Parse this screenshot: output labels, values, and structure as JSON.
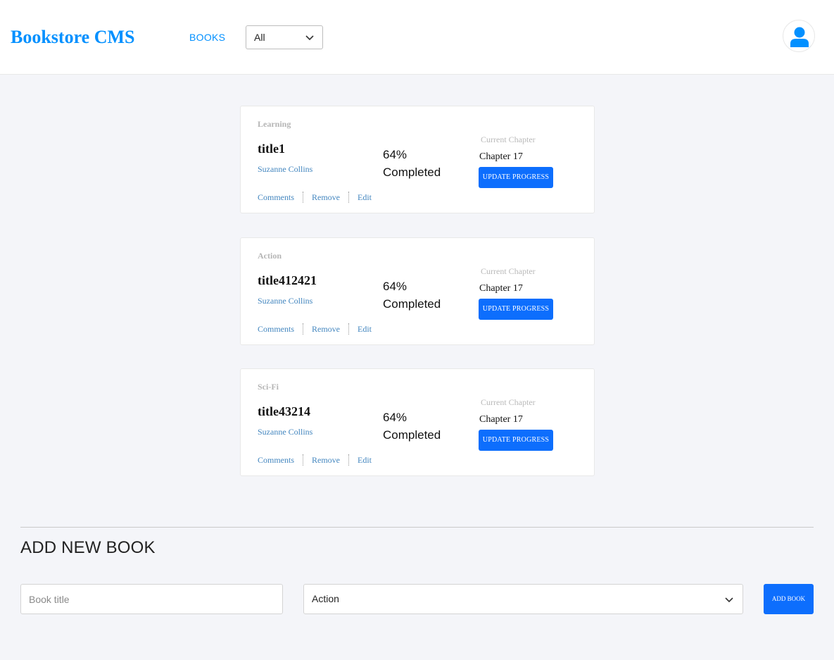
{
  "header": {
    "brand": "Bookstore CMS",
    "nav_books": "BOOKS",
    "filter_value": "All",
    "avatar_icon": "user-icon"
  },
  "books": [
    {
      "category": "Learning",
      "title": "title1",
      "author": "Suzanne Collins",
      "actions": [
        "Comments",
        "Remove",
        "Edit"
      ],
      "progress_percent": "64%",
      "progress_label": "Completed",
      "current_chapter_label": "Current Chapter",
      "chapter": "Chapter 17",
      "update_label": "UPDATE PROGRESS"
    },
    {
      "category": "Action",
      "title": "title412421",
      "author": "Suzanne Collins",
      "actions": [
        "Comments",
        "Remove",
        "Edit"
      ],
      "progress_percent": "64%",
      "progress_label": "Completed",
      "current_chapter_label": "Current Chapter",
      "chapter": "Chapter 17",
      "update_label": "UPDATE PROGRESS"
    },
    {
      "category": "Sci-Fi",
      "title": "title43214",
      "author": "Suzanne Collins",
      "actions": [
        "Comments",
        "Remove",
        "Edit"
      ],
      "progress_percent": "64%",
      "progress_label": "Completed",
      "current_chapter_label": "Current Chapter",
      "chapter": "Chapter 17",
      "update_label": "UPDATE PROGRESS"
    }
  ],
  "add_book": {
    "heading": "ADD NEW BOOK",
    "title_placeholder": "Book title",
    "category_value": "Action",
    "submit_label": "ADD BOOK"
  },
  "colors": {
    "brand": "#0290ff",
    "primary_button": "#0d6efd",
    "author_link": "#4386bf",
    "background": "#f4f5f9"
  }
}
